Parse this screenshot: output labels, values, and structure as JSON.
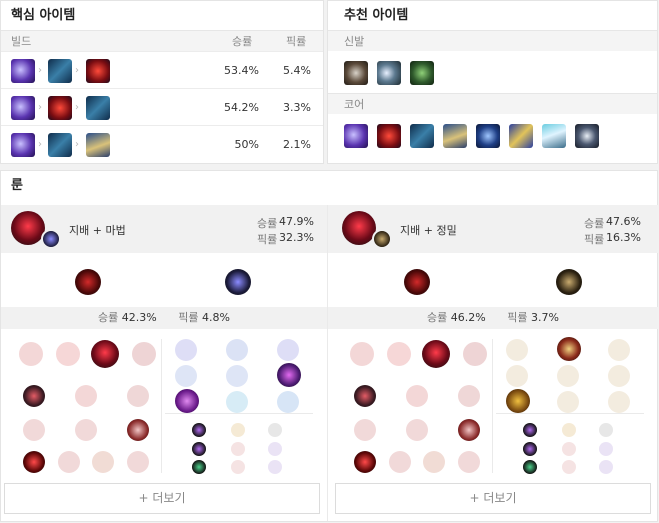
{
  "core_panel": {
    "title": "핵심 아이템",
    "col_build": "빌드",
    "col_win": "승률",
    "col_pick": "픽률",
    "builds": [
      {
        "win": "53.4%",
        "pick": "5.4%"
      },
      {
        "win": "54.2%",
        "pick": "3.3%"
      },
      {
        "win": "50%",
        "pick": "2.1%"
      }
    ]
  },
  "rec_panel": {
    "title": "추천 아이템",
    "boots_label": "신발",
    "core_label": "코어"
  },
  "rune_panel": {
    "title": "룬",
    "pages": [
      {
        "name": "지배 + 마법",
        "win_label": "승률",
        "win": "47.9%",
        "pick_label": "픽률",
        "pick": "32.3%",
        "detail_win": "42.3%",
        "detail_pick": "4.8%"
      },
      {
        "name": "지배 + 정밀",
        "win_label": "승률",
        "win": "47.6%",
        "pick_label": "픽률",
        "pick": "16.3%",
        "detail_win": "46.2%",
        "detail_pick": "3.7%"
      }
    ],
    "more_label": "+ 더보기"
  },
  "colors": {
    "domination": "#b3161c",
    "sorcery": "#5a5acf",
    "precision": "#c8aa6e",
    "panel_bg": "#ffffff"
  }
}
